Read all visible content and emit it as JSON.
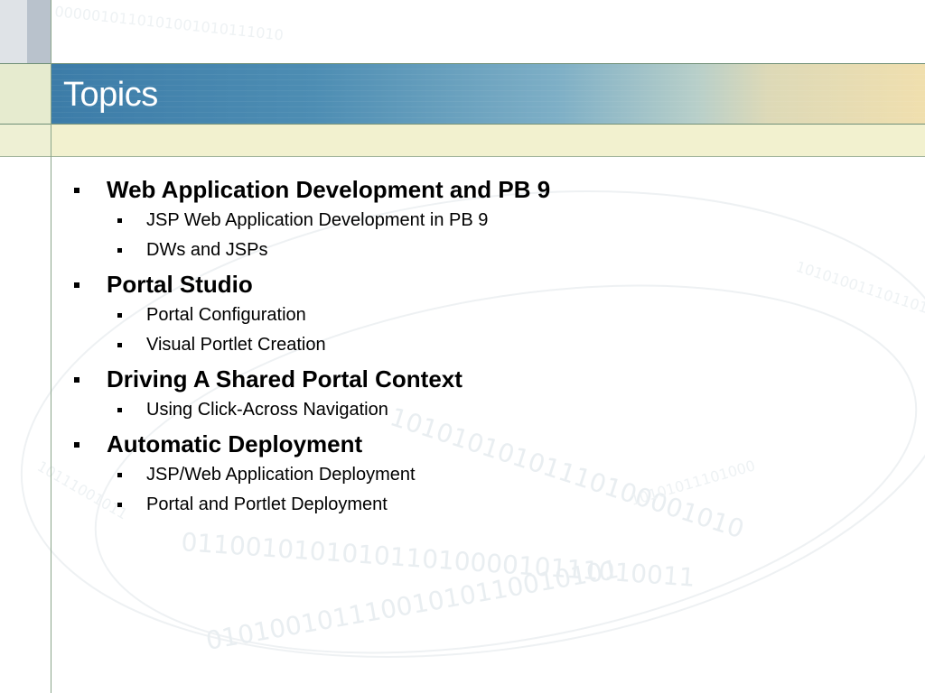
{
  "slide": {
    "title": "Topics",
    "items": [
      {
        "label": "Web Application Development and PB 9",
        "subitems": [
          "JSP Web Application Development in PB 9",
          "DWs and JSPs"
        ]
      },
      {
        "label": "Portal Studio",
        "subitems": [
          "Portal Configuration",
          "Visual Portlet Creation"
        ]
      },
      {
        "label": "Driving A Shared Portal Context",
        "subitems": [
          "Using Click-Across Navigation"
        ]
      },
      {
        "label": "Automatic Deployment",
        "subitems": [
          "JSP/Web Application Deployment",
          "Portal and Portlet Deployment"
        ]
      }
    ]
  },
  "colors": {
    "title_band_start": "#3c7ca8",
    "title_band_end": "#f0dfae",
    "title_text": "#ffffff",
    "body_text": "#000000"
  }
}
